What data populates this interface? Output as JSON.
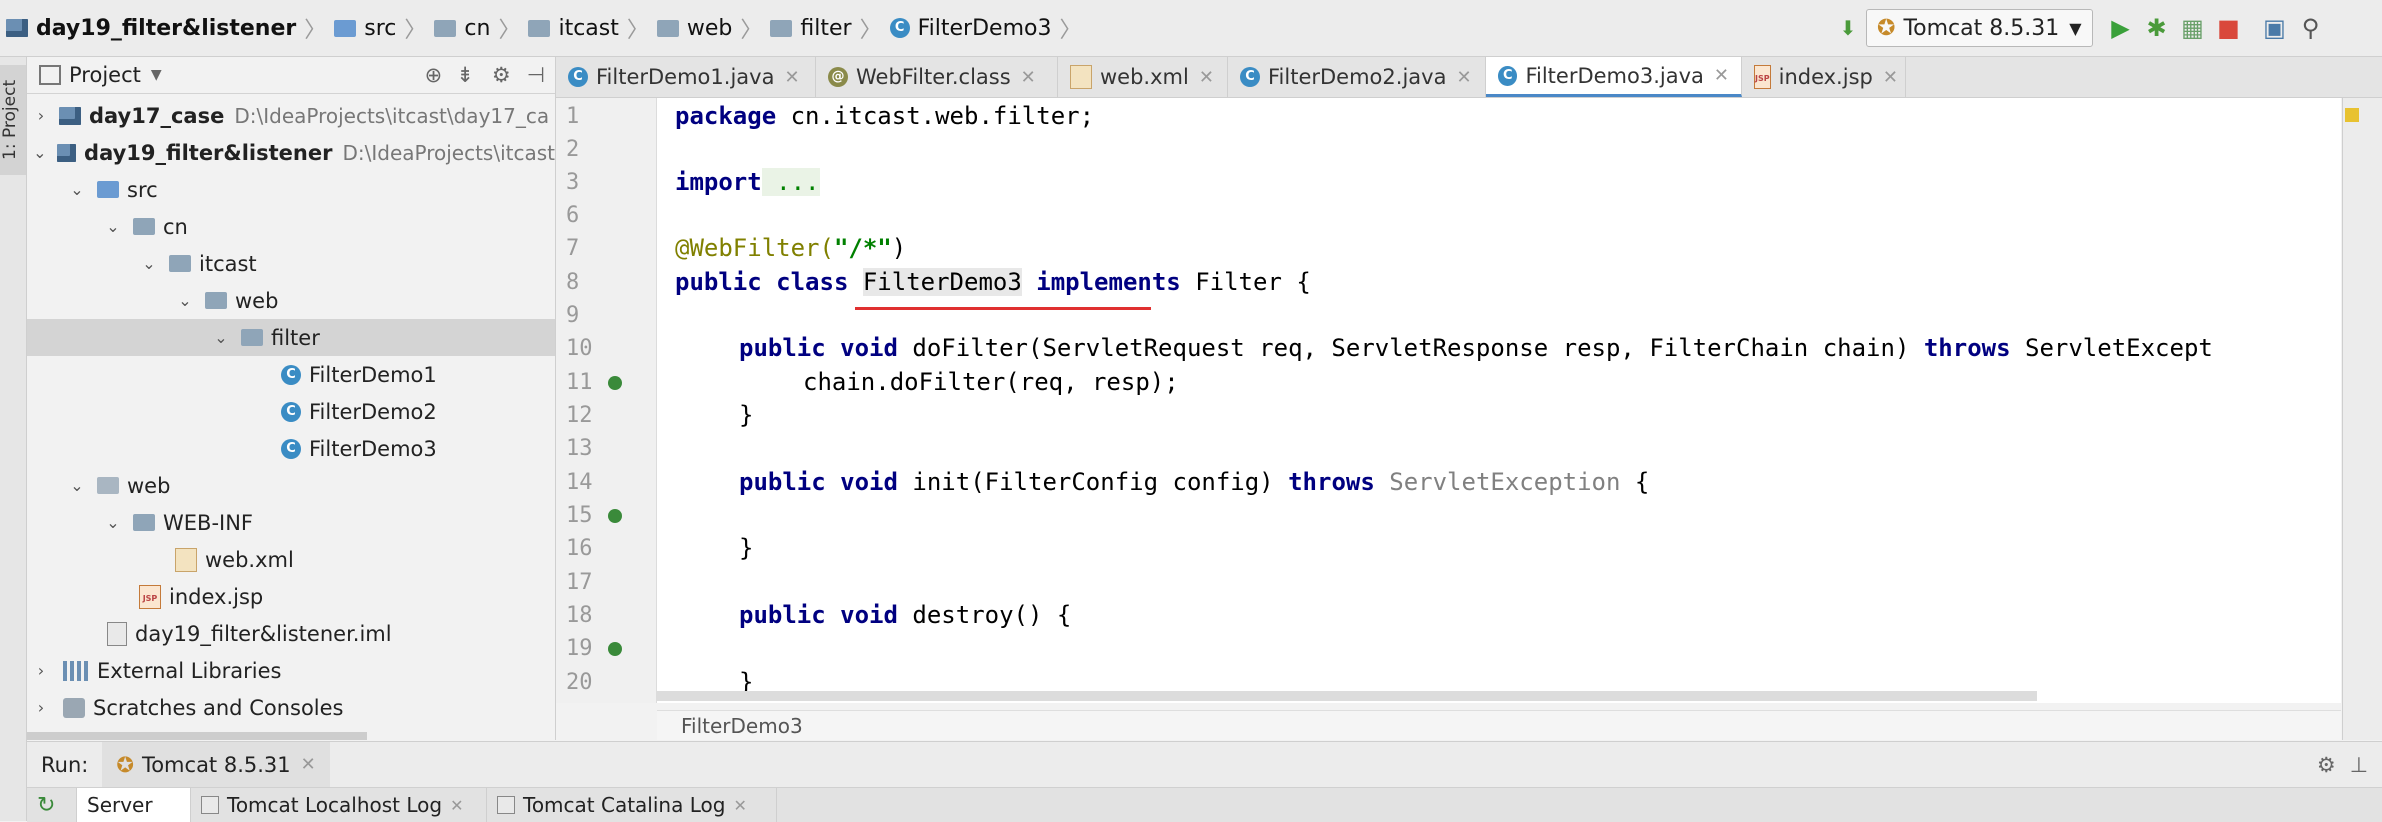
{
  "navbar": {
    "project_name": "day19_filter&listener",
    "crumbs": [
      "src",
      "cn",
      "itcast",
      "web",
      "filter",
      "FilterDemo3"
    ],
    "run_config": "Tomcat 8.5.31"
  },
  "leftstrip": {
    "project_tab": "1: Project"
  },
  "project": {
    "header_label": "Project",
    "tree": [
      {
        "label": "day17_case",
        "path": "D:\\IdeaProjects\\itcast\\day17_ca"
      },
      {
        "label": "day19_filter&listener",
        "path": "D:\\IdeaProjects\\itcast"
      },
      {
        "label": "src"
      },
      {
        "label": "cn"
      },
      {
        "label": "itcast"
      },
      {
        "label": "web"
      },
      {
        "label": "filter"
      },
      {
        "label": "FilterDemo1"
      },
      {
        "label": "FilterDemo2"
      },
      {
        "label": "FilterDemo3"
      },
      {
        "label": "web"
      },
      {
        "label": "WEB-INF"
      },
      {
        "label": "web.xml"
      },
      {
        "label": "index.jsp"
      },
      {
        "label": "day19_filter&listener.iml"
      },
      {
        "label": "External Libraries"
      },
      {
        "label": "Scratches and Consoles"
      }
    ]
  },
  "editor": {
    "tabs": [
      "FilterDemo1.java",
      "WebFilter.class",
      "web.xml",
      "FilterDemo2.java",
      "FilterDemo3.java",
      "index.jsp"
    ],
    "active_tab": "FilterDemo3.java",
    "line_numbers": [
      "1",
      "2",
      "3",
      "6",
      "7",
      "8",
      "9",
      "10",
      "11",
      "12",
      "13",
      "14",
      "15",
      "16",
      "17",
      "18",
      "19",
      "20"
    ],
    "code": {
      "l1_kw": "package",
      "l1_rest": " cn.itcast.web.filter;",
      "l3_kw": "import",
      "l3_rest": " ...",
      "l7_anno": "@WebFilter(",
      "l7_str": "\"/*\"",
      "l7_end": ")",
      "l8_kw": "public class ",
      "l8_name": "FilterDemo3",
      "l8_kw2": " implements",
      "l8_rest": " Filter {",
      "l11_kw": "public void",
      "l11_rest": " doFilter(ServletRequest req, ServletResponse resp, FilterChain chain) ",
      "l11_kw2": "throws",
      "l11_end": " ServletExcept",
      "l12": "chain.doFilter(req, resp);",
      "l13": "}",
      "l15_kw": "public void",
      "l15_rest": " init(FilterConfig config) ",
      "l15_kw2": "throws",
      "l15_dim": " ServletException",
      "l15_end": " {",
      "l17": "}",
      "l19_kw": "public void",
      "l19_rest": " destroy() {",
      "l20": "}"
    },
    "breadcrumb": "FilterDemo3"
  },
  "run": {
    "label": "Run:",
    "config_tab": "Tomcat 8.5.31",
    "subtabs": [
      "Server",
      "Tomcat Localhost Log",
      "Tomcat Catalina Log"
    ]
  },
  "colors": {
    "keyword": "#000080",
    "string": "#008000",
    "annotation": "#808000",
    "accent": "#4a88c7"
  }
}
